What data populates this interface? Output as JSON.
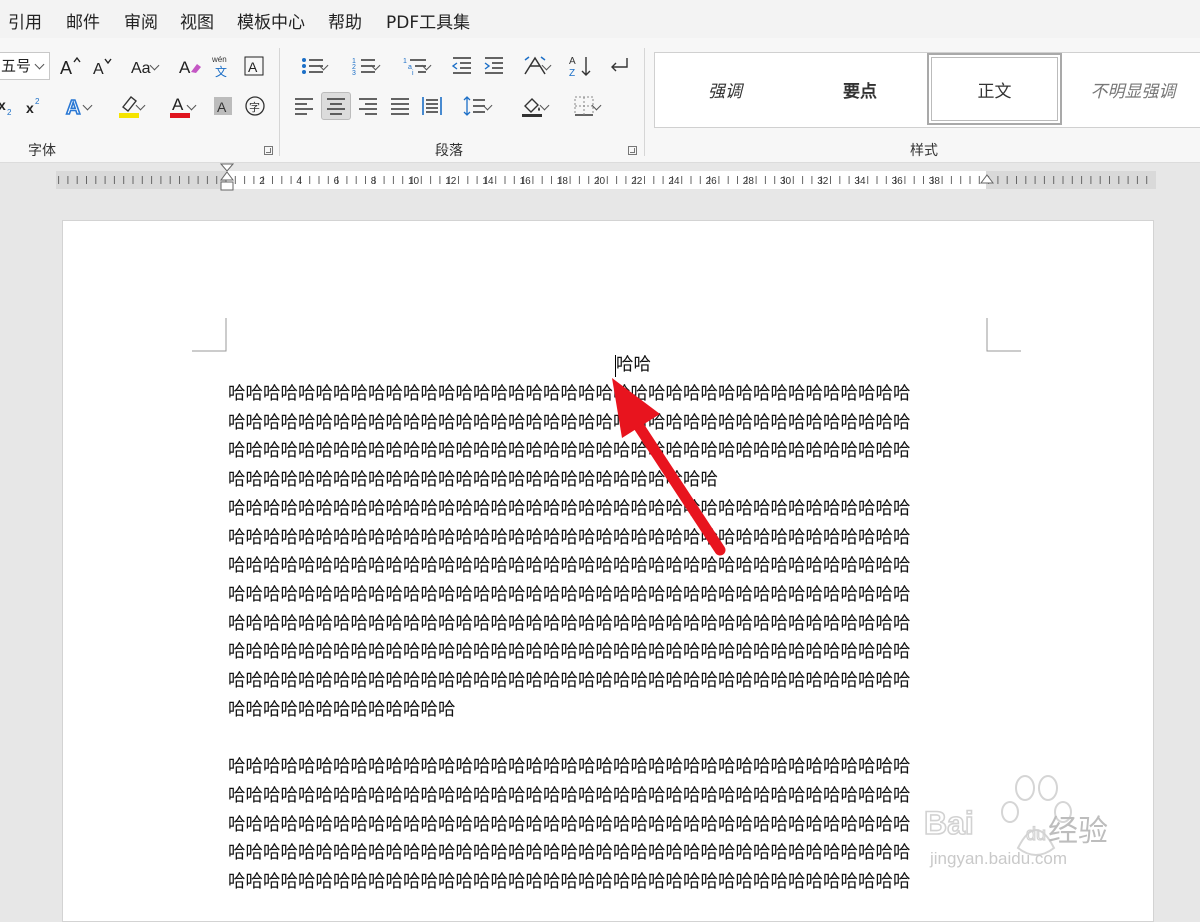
{
  "menu": {
    "tabs": [
      "引用",
      "邮件",
      "审阅",
      "视图",
      "模板中心",
      "帮助",
      "PDF工具集"
    ]
  },
  "font_group": {
    "font_size": "五号",
    "label": "字体",
    "grow_icon": "grow-font-icon",
    "shrink_icon": "shrink-font-icon",
    "highlight_color": "#f5e400",
    "font_color": "#e0141e"
  },
  "paragraph_group": {
    "label": "段落"
  },
  "styles_group": {
    "label": "样式",
    "items": [
      "强调",
      "要点",
      "正文",
      "不明显强调"
    ],
    "selected": "正文"
  },
  "ruler": {
    "numbers": [
      "2",
      "4",
      "6",
      "8",
      "10",
      "12",
      "14",
      "16",
      "18",
      "20",
      "22",
      "24",
      "26",
      "28",
      "30",
      "32",
      "34",
      "36",
      "38"
    ]
  },
  "document": {
    "title": "哈哈",
    "paragraphs": [
      [
        "哈哈哈哈哈哈哈哈哈哈哈哈哈哈哈哈哈哈哈哈哈哈哈哈哈哈哈哈哈哈哈哈哈哈哈哈哈哈哈",
        "哈哈哈哈哈哈哈哈哈哈哈哈哈哈哈哈哈哈哈哈哈哈哈哈哈哈哈哈哈哈哈哈哈哈哈哈哈哈哈",
        "哈哈哈哈哈哈哈哈哈哈哈哈哈哈哈哈哈哈哈哈哈哈哈哈哈哈哈哈哈哈哈哈哈哈哈哈哈哈哈",
        "哈哈哈哈哈哈哈哈哈哈哈哈哈哈哈哈哈哈哈哈哈哈哈哈哈哈哈哈"
      ],
      [
        "哈哈哈哈哈哈哈哈哈哈哈哈哈哈哈哈哈哈哈哈哈哈哈哈哈哈哈哈哈哈哈哈哈哈哈哈哈哈哈",
        "哈哈哈哈哈哈哈哈哈哈哈哈哈哈哈哈哈哈哈哈哈哈哈哈哈哈哈哈哈哈哈哈哈哈哈哈哈哈哈",
        "哈哈哈哈哈哈哈哈哈哈哈哈哈哈哈哈哈哈哈哈哈哈哈哈哈哈哈哈哈哈哈哈哈哈哈哈哈哈哈",
        "哈哈哈哈哈哈哈哈哈哈哈哈哈哈哈哈哈哈哈哈哈哈哈哈哈哈哈哈哈哈哈哈哈哈哈哈哈哈哈",
        "哈哈哈哈哈哈哈哈哈哈哈哈哈哈哈哈哈哈哈哈哈哈哈哈哈哈哈哈哈哈哈哈哈哈哈哈哈哈哈",
        "哈哈哈哈哈哈哈哈哈哈哈哈哈哈哈哈哈哈哈哈哈哈哈哈哈哈哈哈哈哈哈哈哈哈哈哈哈哈哈",
        "哈哈哈哈哈哈哈哈哈哈哈哈哈哈哈哈哈哈哈哈哈哈哈哈哈哈哈哈哈哈哈哈哈哈哈哈哈哈哈",
        "哈哈哈哈哈哈哈哈哈哈哈哈哈"
      ],
      [
        "哈哈哈哈哈哈哈哈哈哈哈哈哈哈哈哈哈哈哈哈哈哈哈哈哈哈哈哈哈哈哈哈哈哈哈哈哈哈哈",
        "哈哈哈哈哈哈哈哈哈哈哈哈哈哈哈哈哈哈哈哈哈哈哈哈哈哈哈哈哈哈哈哈哈哈哈哈哈哈哈",
        "哈哈哈哈哈哈哈哈哈哈哈哈哈哈哈哈哈哈哈哈哈哈哈哈哈哈哈哈哈哈哈哈哈哈哈哈哈哈哈",
        "哈哈哈哈哈哈哈哈哈哈哈哈哈哈哈哈哈哈哈哈哈哈哈哈哈哈哈哈哈哈哈哈哈哈哈哈哈哈哈",
        "哈哈哈哈哈哈哈哈哈哈哈哈哈哈哈哈哈哈哈哈哈哈哈哈哈哈哈哈哈哈哈哈哈哈哈哈哈哈哈"
      ]
    ]
  },
  "annotation": {
    "arrow_color": "#e8141e"
  },
  "watermark": {
    "brand": "Bai",
    "brand2": "du",
    "text": "经验",
    "url": "jingyan.baidu.com"
  }
}
